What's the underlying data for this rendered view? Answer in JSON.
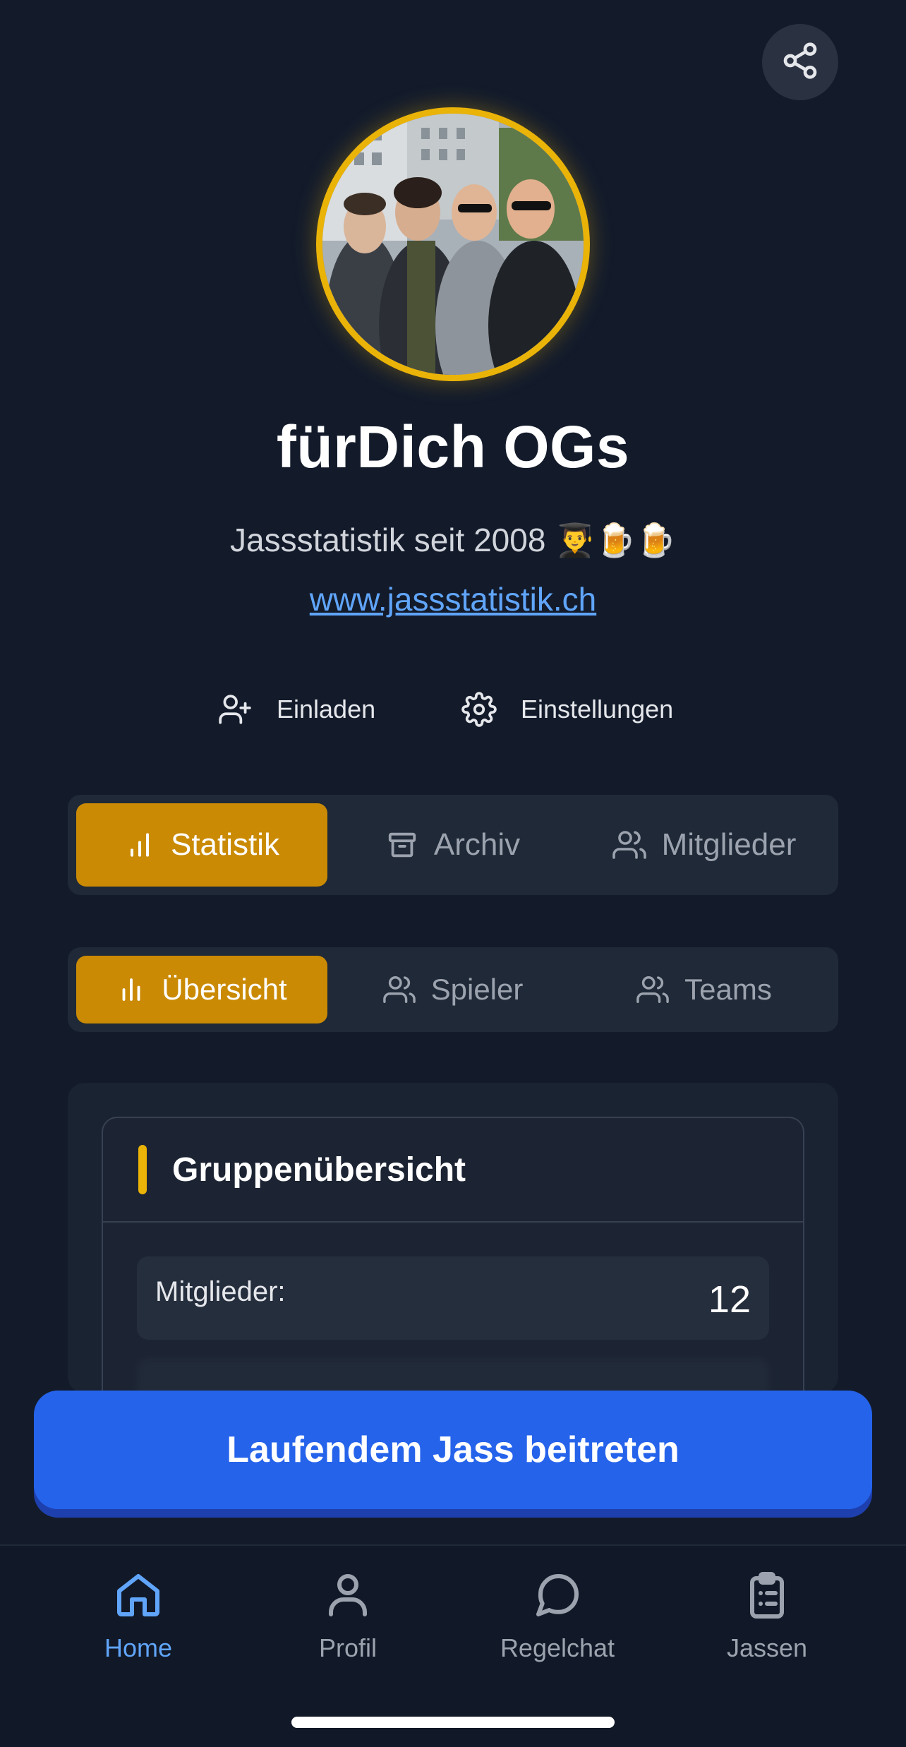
{
  "header": {
    "share_icon": "share-icon"
  },
  "group": {
    "name": "fürDich OGs",
    "subtitle": "Jassstatistik seit 2008 👨‍🎓🍺🍺",
    "link": "www.jassstatistik.ch"
  },
  "actions": {
    "invite_label": "Einladen",
    "settings_label": "Einstellungen"
  },
  "main_tabs": [
    {
      "label": "Statistik",
      "icon": "bar-chart-icon",
      "active": true
    },
    {
      "label": "Archiv",
      "icon": "archive-icon",
      "active": false
    },
    {
      "label": "Mitglieder",
      "icon": "users-icon",
      "active": false
    }
  ],
  "sub_tabs": [
    {
      "label": "Übersicht",
      "icon": "bar-chart-icon",
      "active": true
    },
    {
      "label": "Spieler",
      "icon": "users-icon",
      "active": false
    },
    {
      "label": "Teams",
      "icon": "users-icon",
      "active": false
    }
  ],
  "overview": {
    "title": "Gruppenübersicht",
    "rows": [
      {
        "label": "Mitglieder:",
        "value": "12"
      }
    ]
  },
  "join_button": "Laufendem Jass beitreten",
  "nav": [
    {
      "label": "Home",
      "icon": "home-icon",
      "active": true
    },
    {
      "label": "Profil",
      "icon": "user-icon",
      "active": false
    },
    {
      "label": "Regelchat",
      "icon": "chat-bubble-icon",
      "active": false
    },
    {
      "label": "Jassen",
      "icon": "clipboard-icon",
      "active": false
    }
  ],
  "colors": {
    "background": "#131b2b",
    "accent_gold": "#ca8a04",
    "avatar_ring": "#eab308",
    "primary_blue": "#2563eb",
    "link_blue": "#60a5fa"
  }
}
